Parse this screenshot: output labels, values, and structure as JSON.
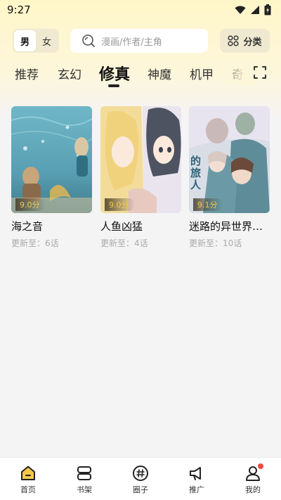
{
  "status_bar": {
    "time": "9:27"
  },
  "gender": {
    "options": [
      "男",
      "女"
    ],
    "selected": "男"
  },
  "search": {
    "placeholder": "漫画/作者/主角"
  },
  "category_button": {
    "label": "分类"
  },
  "tabs": [
    {
      "label": "推荐"
    },
    {
      "label": "玄幻"
    },
    {
      "label": "修真",
      "active": true
    },
    {
      "label": "神魔"
    },
    {
      "label": "机甲"
    },
    {
      "label": "奇"
    }
  ],
  "comics": [
    {
      "title": "海之音",
      "score": "9.0分",
      "update": "更新至：6话"
    },
    {
      "title": "人鱼凶猛",
      "score": "9.0分",
      "update": "更新至：4话"
    },
    {
      "title": "迷路的异世界旅人",
      "score": "9.1分",
      "update": "更新至：10话",
      "cover_text": "的旅人"
    }
  ],
  "bottom_nav": [
    {
      "label": "首页",
      "icon": "home-icon",
      "active": true
    },
    {
      "label": "书架",
      "icon": "bookshelf-icon"
    },
    {
      "label": "圈子",
      "icon": "hashtag-icon"
    },
    {
      "label": "推广",
      "icon": "megaphone-icon"
    },
    {
      "label": "我的",
      "icon": "profile-icon",
      "badge": true
    }
  ],
  "colors": {
    "accent": "#f5c84a",
    "header_bg": "#fff6c8",
    "page_bg": "#f4f4f4",
    "badge": "#f04b3a"
  }
}
